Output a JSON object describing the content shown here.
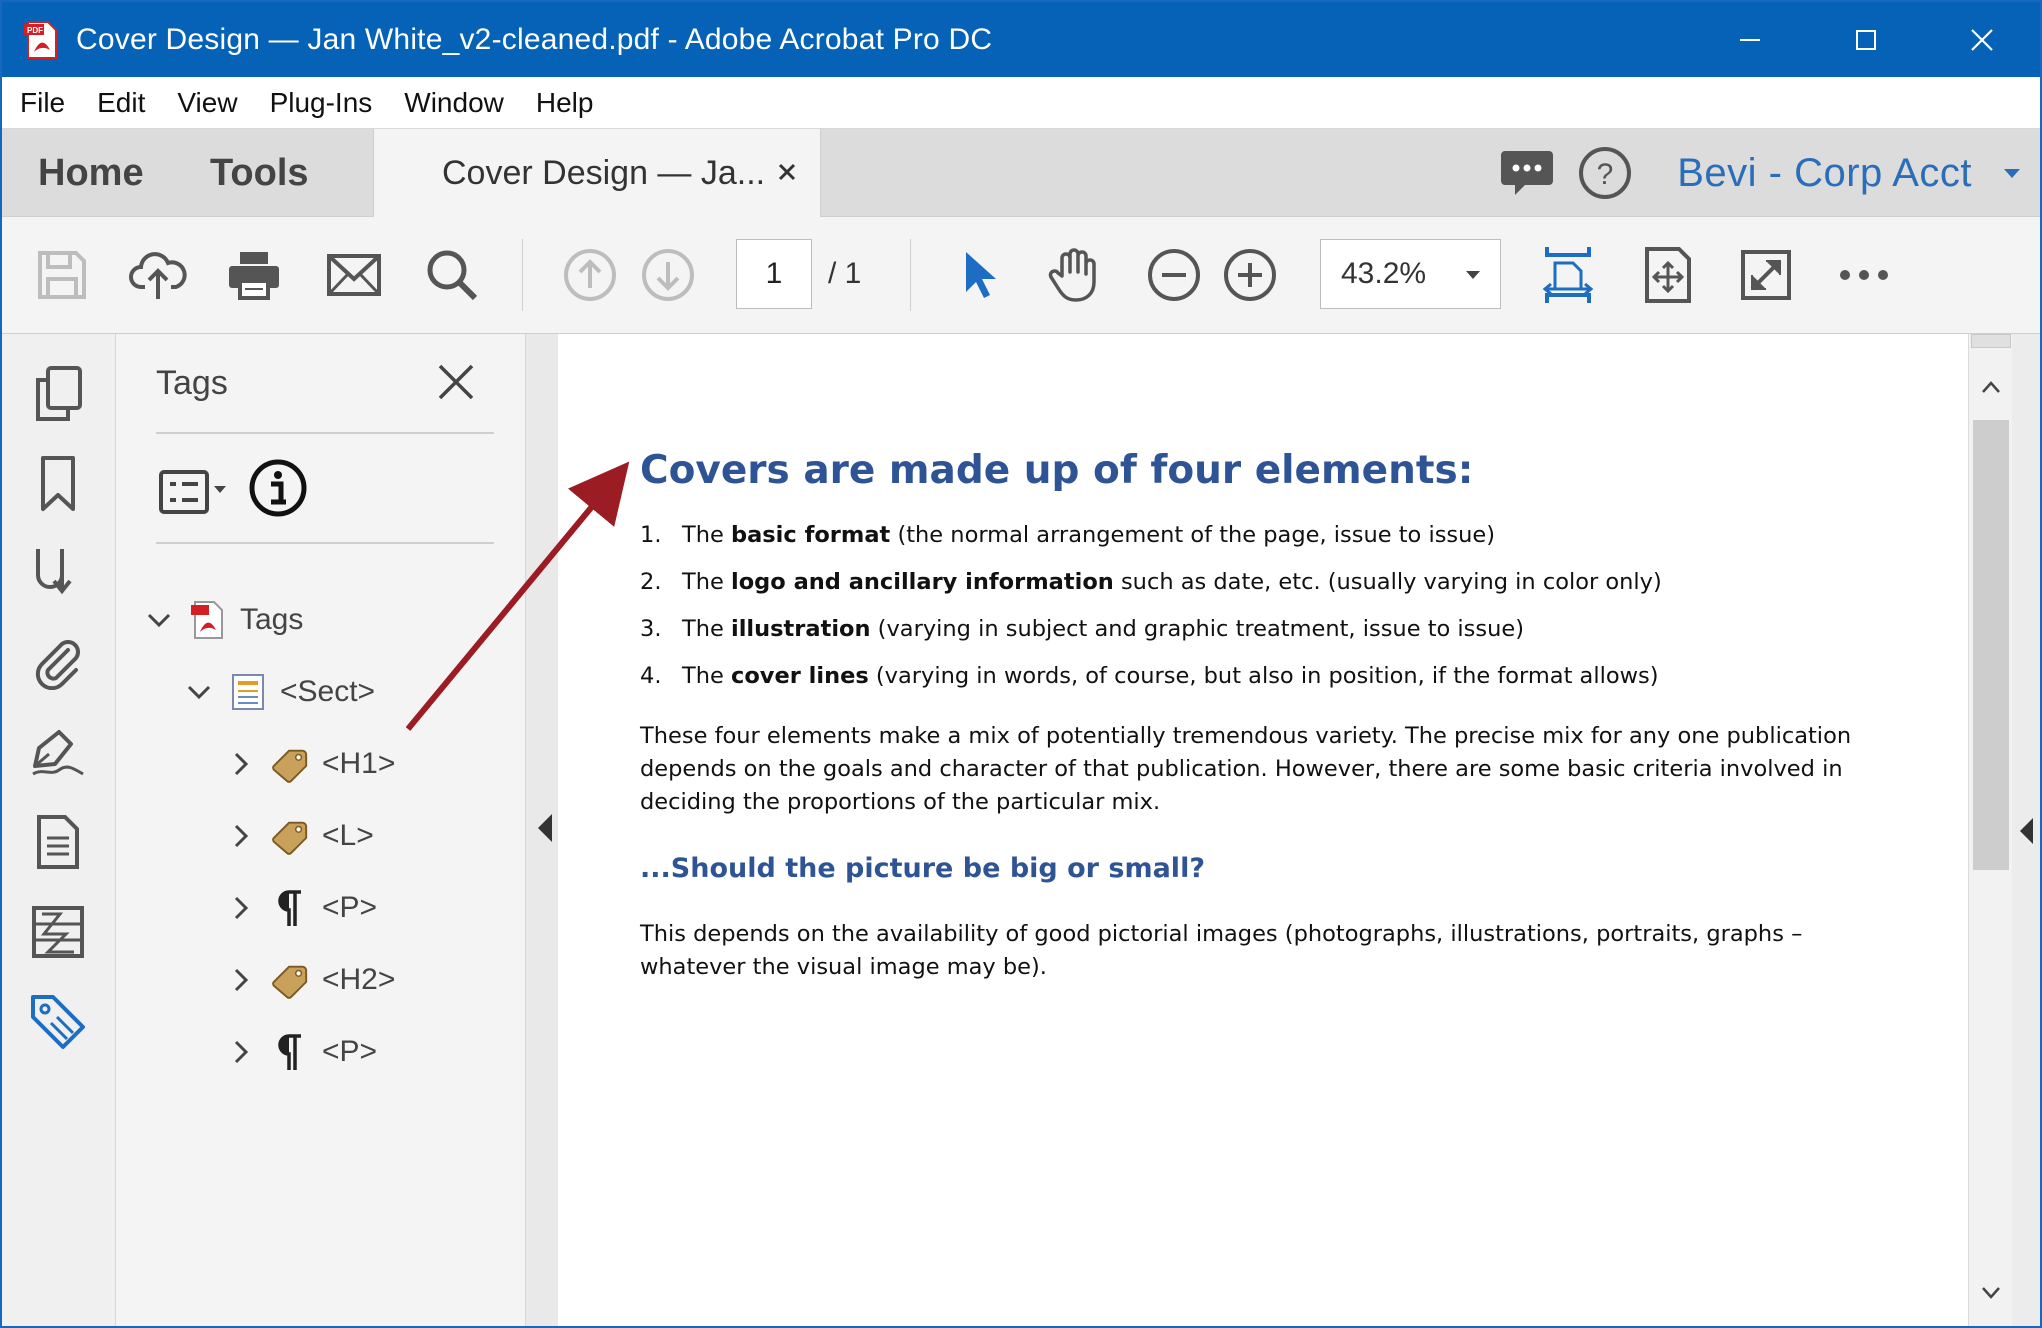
{
  "window": {
    "title": "Cover Design — Jan White_v2-cleaned.pdf - Adobe Acrobat Pro DC"
  },
  "menu": [
    "File",
    "Edit",
    "View",
    "Plug-Ins",
    "Window",
    "Help"
  ],
  "tabs": {
    "home": "Home",
    "tools": "Tools",
    "document": "Cover Design — Ja...",
    "account": "Bevi - Corp Acct"
  },
  "toolbar": {
    "page_current": "1",
    "page_total": "/ 1",
    "zoom": "43.2%"
  },
  "tags_panel": {
    "title": "Tags",
    "tree": [
      {
        "label": "Tags",
        "icon": "pdf-icon",
        "expanded": true
      },
      {
        "label": "<Sect>",
        "icon": "section-icon",
        "expanded": true
      },
      {
        "label": "<H1>",
        "icon": "tag-icon",
        "expanded": false
      },
      {
        "label": "<L>",
        "icon": "tag-icon",
        "expanded": false
      },
      {
        "label": "<P>",
        "icon": "paragraph-icon",
        "expanded": false
      },
      {
        "label": "<H2>",
        "icon": "tag-icon",
        "expanded": false
      },
      {
        "label": "<P>",
        "icon": "paragraph-icon",
        "expanded": false
      }
    ]
  },
  "document": {
    "heading": "Covers are made up of four elements:",
    "list": [
      {
        "num": "1.",
        "pre": "The ",
        "bold": "basic format",
        "rest": " (the normal arrangement of the page, issue to issue)"
      },
      {
        "num": "2.",
        "pre": "The ",
        "bold": "logo and ancillary information",
        "rest": " such as date, etc. (usually varying in color only)"
      },
      {
        "num": "3.",
        "pre": "The ",
        "bold": "illustration",
        "rest": " (varying in subject and graphic treatment, issue to issue)"
      },
      {
        "num": "4.",
        "pre": "The ",
        "bold": "cover lines",
        "rest": " (varying in words, of course, but also in position, if the format allows)"
      }
    ],
    "paragraph1": "These four elements make a mix of potentially tremendous variety. The precise mix for any one publication depends on the goals and character of that publication. However, there are some basic criteria involved in deciding the proportions of the particular mix.",
    "subheading": "...Should the picture be big or small?",
    "paragraph2": "This depends on the availability of good pictorial images (photographs, illustrations, portraits, graphs – whatever the visual image may be)."
  },
  "colors": {
    "titlebar": "#0562b6",
    "accent": "#2a6ebb",
    "heading": "#2f5496",
    "annotation_arrow": "#9b1c22"
  }
}
